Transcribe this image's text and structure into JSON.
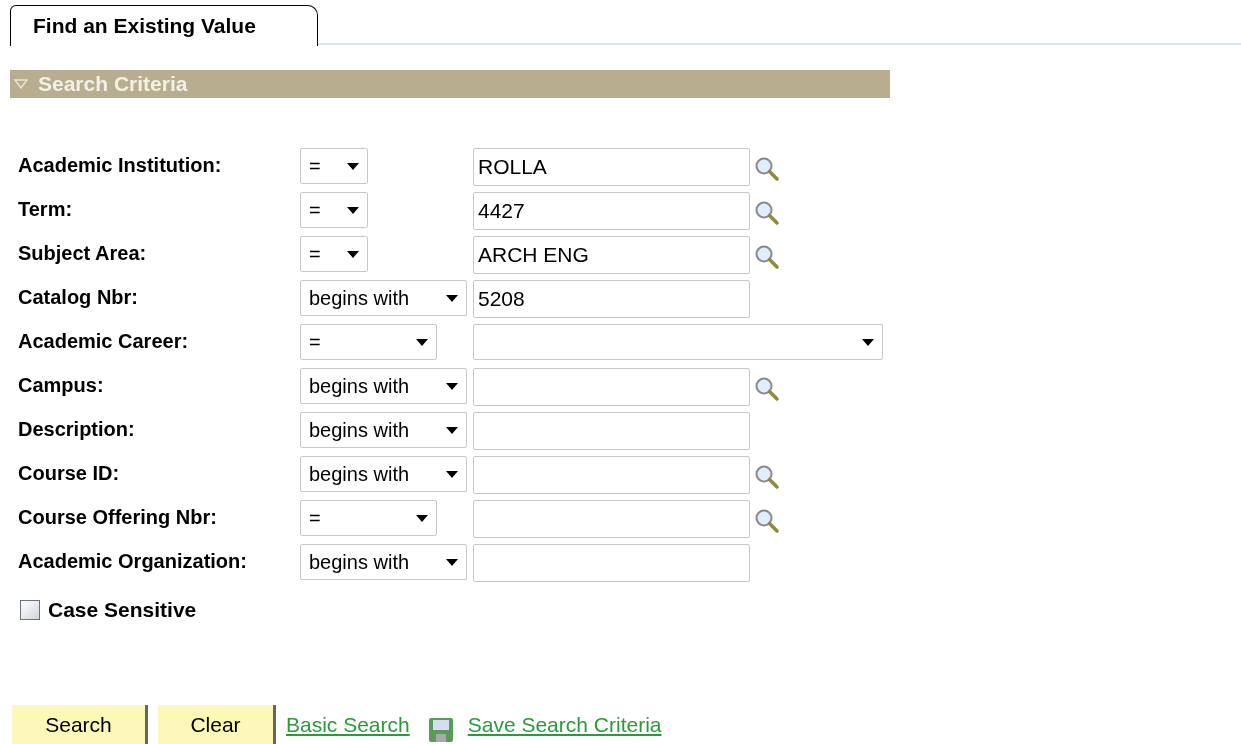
{
  "tab": {
    "label": "Find an Existing Value",
    "selected": true
  },
  "section": {
    "title": "Search Criteria",
    "expanded": true
  },
  "fields": [
    {
      "label": "Academic Institution:",
      "operator": "=",
      "kind": "lookup",
      "value": "ROLLA"
    },
    {
      "label": "Term:",
      "operator": "=",
      "kind": "lookup",
      "value": "4427"
    },
    {
      "label": "Subject Area:",
      "operator": "=",
      "kind": "lookup",
      "value": "ARCH ENG"
    },
    {
      "label": "Catalog Nbr:",
      "operator": "begins with",
      "kind": "text",
      "value": "5208"
    },
    {
      "label": "Academic Career:",
      "operator": "=",
      "kind": "dropdown"
    },
    {
      "label": "Campus:",
      "operator": "begins with",
      "kind": "lookup"
    },
    {
      "label": "Description:",
      "operator": "begins with",
      "kind": "text"
    },
    {
      "label": "Course ID:",
      "operator": "begins with",
      "kind": "lookup"
    },
    {
      "label": "Course Offering Nbr:",
      "operator": "=",
      "kind": "lookup"
    },
    {
      "label": "Academic Organization:",
      "operator": "begins with",
      "kind": "text"
    }
  ],
  "case_sensitive": {
    "label": "Case Sensitive",
    "checked": false
  },
  "buttons": [
    "Search",
    "Clear"
  ],
  "links": [
    {
      "label": "Basic Search",
      "icon": false
    },
    {
      "label": "Save Search Criteria",
      "icon": true
    }
  ]
}
